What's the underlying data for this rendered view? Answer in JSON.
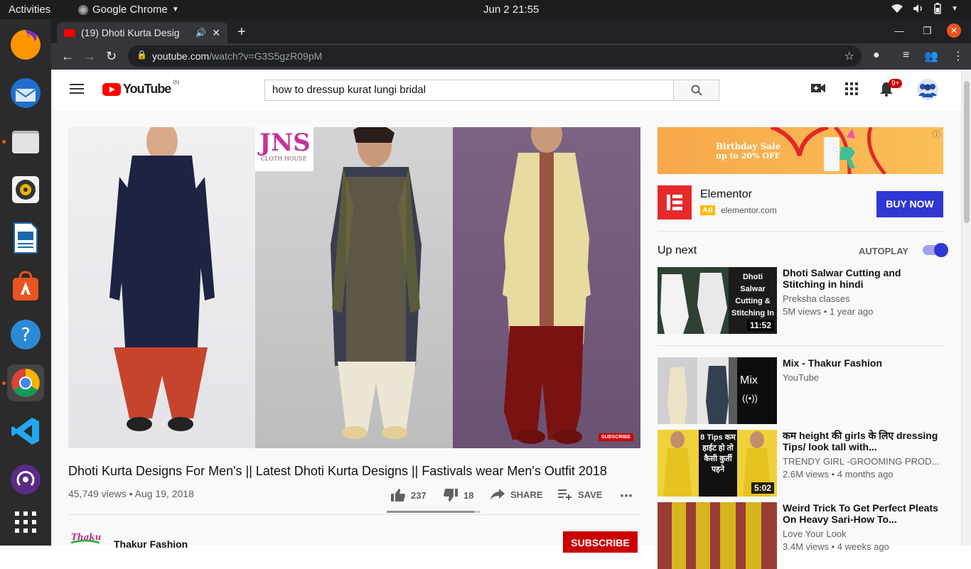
{
  "os": {
    "activities": "Activities",
    "app_name": "Google Chrome",
    "clock": "Jun 2  21:55"
  },
  "browser": {
    "tab_title": "(19) Dhoti Kurta Desig",
    "url_host": "youtube.com",
    "url_path": "/watch?v=G3S5gzR09pM"
  },
  "youtube": {
    "logo_text": "YouTube",
    "country": "IN",
    "search_value": "how to dressup kurat lungi bridal",
    "notification_count": "9+",
    "video": {
      "title": "Dhoti Kurta Designs For Men's || Latest Dhoti Kurta Designs || Fastivals wear Men's Outfit 2018",
      "views": "45,749 views • Aug 19, 2018",
      "likes": "237",
      "dislikes": "18",
      "like_ratio": 0.93,
      "share_label": "SHARE",
      "save_label": "SAVE",
      "watermark": "JNS",
      "watermark_sub": "CLOTH HOUSE",
      "subscribe_watermark": "SUBSCRIBE"
    },
    "channel": {
      "name": "Thakur Fashion",
      "subscribe_label": "SUBSCRIBE"
    },
    "ad": {
      "banner_line1": "Birthday Sale",
      "banner_line2": "up to 20% OFF",
      "name": "Elementor",
      "tag": "Ad",
      "domain": "elementor.com",
      "cta": "BUY NOW"
    },
    "up_next_label": "Up next",
    "autoplay_label": "AUTOPLAY",
    "autoplay_on": true,
    "recommendations": [
      {
        "title": "Dhoti Salwar Cutting and Stitching in hindi",
        "channel": "Preksha classes",
        "meta": "5M views • 1 year ago",
        "duration": "11:52",
        "thumb_text": "Dhoti Salwar Cutting & Stitching In"
      },
      {
        "title": "Mix - Thakur Fashion",
        "channel": "YouTube",
        "meta": "",
        "duration": "",
        "thumb_text": "Mix"
      },
      {
        "title": "कम height की girls के लिए dressing Tips/ look tall with...",
        "channel": "TRENDY GIRL -GROOMING PROD...",
        "meta": "2.6M views • 4 months ago",
        "duration": "5:02",
        "thumb_text": "8 Tips कम हाईट हो तो कैसी कुर्ती पहने"
      },
      {
        "title": "Weird Trick To Get Perfect Pleats On Heavy Sari-How To...",
        "channel": "Love Your Look",
        "meta": "3.4M views • 4 weeks ago",
        "duration": "",
        "thumb_text": ""
      }
    ]
  }
}
